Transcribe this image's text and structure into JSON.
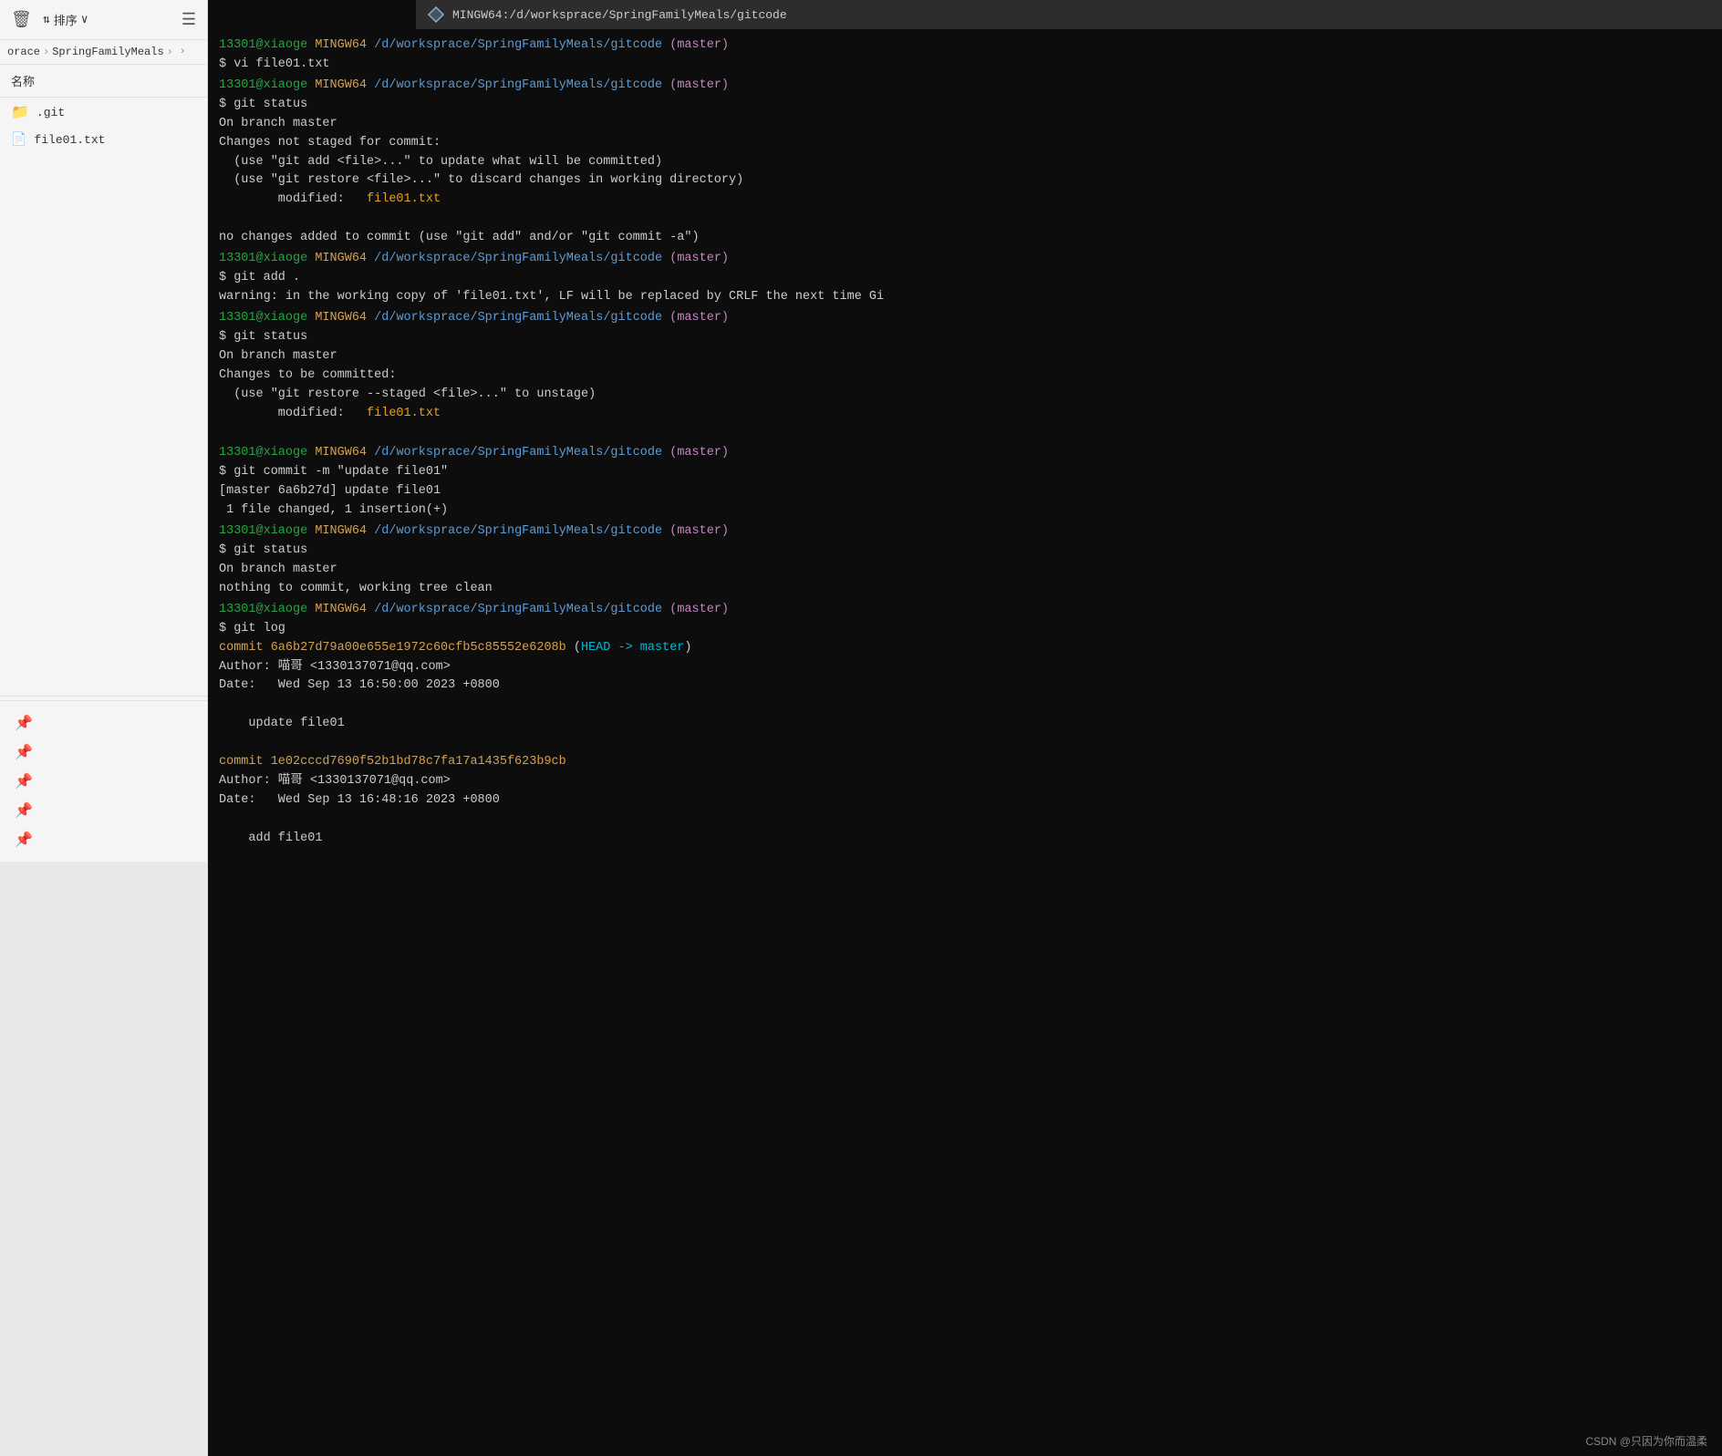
{
  "titlebar": {
    "title": "MINGW64:/d/worksprace/SpringFamilyMeals/gitcode"
  },
  "sidebar": {
    "sort_label": "排序",
    "header_label": "名称",
    "breadcrumbs": [
      "orace",
      "SpringFamilyMeals"
    ],
    "files": [
      {
        "name": ".git",
        "type": "folder"
      },
      {
        "name": "file01.txt",
        "type": "file"
      }
    ],
    "pins": [
      "pin1",
      "pin2",
      "pin3",
      "pin4",
      "pin5"
    ]
  },
  "terminal": {
    "blocks": [
      {
        "prompt": "13301@xiaoge MINGW64 /d/worksprace/SpringFamilyMeals/gitcode (master)",
        "command": "$ vi file01.txt",
        "output": []
      },
      {
        "prompt": "13301@xiaoge MINGW64 /d/worksprace/SpringFamilyMeals/gitcode (master)",
        "command": "$ git status",
        "output": [
          {
            "text": "On branch master",
            "type": "normal"
          },
          {
            "text": "Changes not staged for commit:",
            "type": "normal"
          },
          {
            "text": "  (use \"git add <file>...\" to update what will be committed)",
            "type": "normal"
          },
          {
            "text": "  (use \"git restore <file>...\" to discard changes in working directory)",
            "type": "normal"
          },
          {
            "text": "\tmodified:   file01.txt",
            "type": "modified"
          },
          {
            "text": "",
            "type": "normal"
          },
          {
            "text": "no changes added to commit (use \"git add\" and/or \"git commit -a\")",
            "type": "normal"
          }
        ]
      },
      {
        "prompt": "13301@xiaoge MINGW64 /d/worksprace/SpringFamilyMeals/gitcode (master)",
        "command": "$ git add .",
        "output": [
          {
            "text": "warning: in the working copy of 'file01.txt', LF will be replaced by CRLF the next time Gi",
            "type": "normal"
          }
        ]
      },
      {
        "prompt": "13301@xiaoge MINGW64 /d/worksprace/SpringFamilyMeals/gitcode (master)",
        "command": "$ git status",
        "output": [
          {
            "text": "On branch master",
            "type": "normal"
          },
          {
            "text": "Changes to be committed:",
            "type": "normal"
          },
          {
            "text": "  (use \"git restore --staged <file>...\" to unstage)",
            "type": "normal"
          },
          {
            "text": "\tmodified:   file01.txt",
            "type": "modified"
          },
          {
            "text": "",
            "type": "normal"
          }
        ]
      },
      {
        "prompt": "13301@xiaoge MINGW64 /d/worksprace/SpringFamilyMeals/gitcode (master)",
        "command": "$ git commit -m \"update file01\"",
        "output": [
          {
            "text": "[master 6a6b27d] update file01",
            "type": "normal"
          },
          {
            "text": " 1 file changed, 1 insertion(+)",
            "type": "normal"
          }
        ]
      },
      {
        "prompt": "13301@xiaoge MINGW64 /d/worksprace/SpringFamilyMeals/gitcode (master)",
        "command": "$ git status",
        "output": [
          {
            "text": "On branch master",
            "type": "normal"
          },
          {
            "text": "nothing to commit, working tree clean",
            "type": "normal"
          }
        ]
      },
      {
        "prompt": "13301@xiaoge MINGW64 /d/worksprace/SpringFamilyMeals/gitcode (master)",
        "command": "$ git log",
        "output": [
          {
            "text": "commit 6a6b27d79a00e655e1972c60cfb5c85552e6208b (HEAD -> master)",
            "type": "commit"
          },
          {
            "text": "Author: 喵哥 <1330137071@qq.com>",
            "type": "normal"
          },
          {
            "text": "Date:   Wed Sep 13 16:50:00 2023 +0800",
            "type": "normal"
          },
          {
            "text": "",
            "type": "normal"
          },
          {
            "text": "    update file01",
            "type": "normal"
          },
          {
            "text": "",
            "type": "normal"
          },
          {
            "text": "commit 1e02cccd7690f52b1bd78c7fa17a1435f623b9cb",
            "type": "commit2"
          },
          {
            "text": "Author: 喵哥 <1330137071@qq.com>",
            "type": "normal"
          },
          {
            "text": "Date:   Wed Sep 13 16:48:16 2023 +0800",
            "type": "normal"
          },
          {
            "text": "",
            "type": "normal"
          },
          {
            "text": "    add file01",
            "type": "normal"
          }
        ]
      }
    ]
  },
  "watermark": {
    "text": "CSDN @只因为你而温柔"
  }
}
